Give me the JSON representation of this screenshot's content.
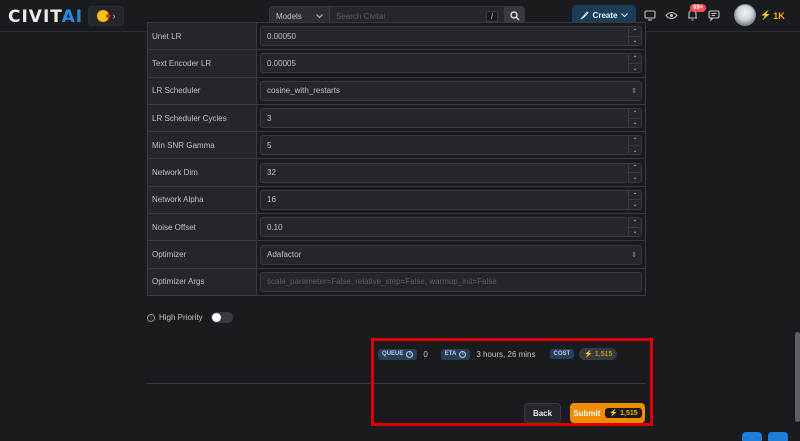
{
  "header": {
    "logo_main": "CIVIT",
    "logo_ai": "AI",
    "search": {
      "category": "Models",
      "placeholder": "Search Civitai",
      "shortcut": "/"
    },
    "create_label": "Create",
    "notification_count": "99+",
    "buzz_balance": "1K"
  },
  "training": {
    "rows": [
      {
        "label": "Unet LR",
        "value": "0.00050",
        "kind": "number"
      },
      {
        "label": "Text Encoder LR",
        "value": "0.00005",
        "kind": "number"
      },
      {
        "label": "LR Scheduler",
        "value": "cosine_with_restarts",
        "kind": "select"
      },
      {
        "label": "LR Scheduler Cycles",
        "value": "3",
        "kind": "number"
      },
      {
        "label": "Min SNR Gamma",
        "value": "5",
        "kind": "number"
      },
      {
        "label": "Network Dim",
        "value": "32",
        "kind": "number"
      },
      {
        "label": "Network Alpha",
        "value": "16",
        "kind": "number"
      },
      {
        "label": "Noise Offset",
        "value": "0.10",
        "kind": "number"
      },
      {
        "label": "Optimizer",
        "value": "Adafactor",
        "kind": "select"
      },
      {
        "label": "Optimizer Args",
        "value": "",
        "placeholder": "scale_parameter=False, relative_step=False, warmup_init=False",
        "kind": "text"
      }
    ],
    "high_priority_label": "High Priority",
    "high_priority_enabled": false
  },
  "queue": {
    "queue_label": "QUEUE",
    "queue_value": "0",
    "eta_label": "ETA",
    "eta_value": "3 hours, 26 mins",
    "cost_label": "COST",
    "cost_value": "1,515"
  },
  "actions": {
    "back_label": "Back",
    "submit_label": "Submit",
    "submit_cost": "1,515"
  },
  "colors": {
    "accent": "#f08c00",
    "buzz": "#fab005",
    "highlight": "#e00000"
  }
}
